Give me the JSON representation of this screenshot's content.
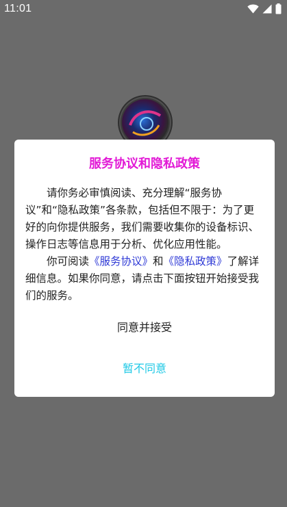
{
  "status_bar": {
    "time": "11:01",
    "icons": [
      "wifi-icon",
      "cellular-signal-icon",
      "battery-icon"
    ]
  },
  "background": {
    "logo": "app-logo-icon"
  },
  "dialog": {
    "title": "服务协议和隐私政策",
    "paragraph1": "请你务必审慎阅读、充分理解“服务协议”和“隐私政策”各条款，包括但不限于：为了更好的向你提供服务，我们需要收集你的设备标识、操作日志等信息用于分析、优化应用性能。",
    "paragraph2_prefix": "你可阅读",
    "service_agreement_link": "《服务协议》",
    "paragraph2_and": "和",
    "privacy_policy_link": "《隐私政策》",
    "paragraph2_suffix": "了解详细信息。如果你同意，请点击下面按钮开始接受我们的服务。",
    "agree_label": "同意并接受",
    "disagree_label": "暂不同意"
  },
  "colors": {
    "title": "#e21ad6",
    "link": "#2f3ad6",
    "disagree": "#1ec8e6",
    "overlay": "#6b6b6b"
  }
}
